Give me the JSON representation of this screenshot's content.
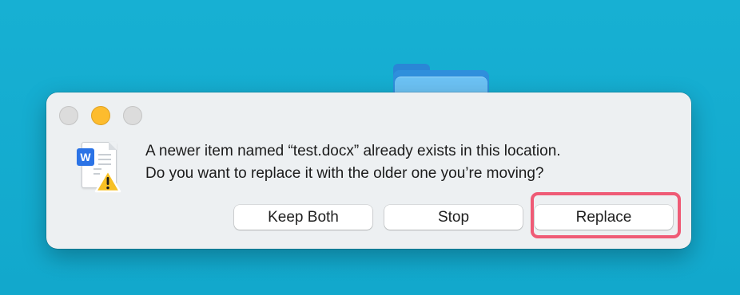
{
  "dialog": {
    "message_line1": "A newer item named “test.docx” already exists in this location.",
    "message_line2": "Do you want to replace it with the older one you’re moving?",
    "file_badge_letter": "W",
    "buttons": {
      "keep_both": "Keep Both",
      "stop": "Stop",
      "replace": "Replace"
    }
  },
  "colors": {
    "desktop_background": "#14acd0",
    "dialog_background": "#edf0f2",
    "minimize_button": "#fdbc2e",
    "highlight_outline": "#ef5b76",
    "word_badge": "#2b73e6"
  },
  "icons": {
    "document": "word-document-icon",
    "warning": "warning-icon",
    "folder": "folder-icon"
  }
}
